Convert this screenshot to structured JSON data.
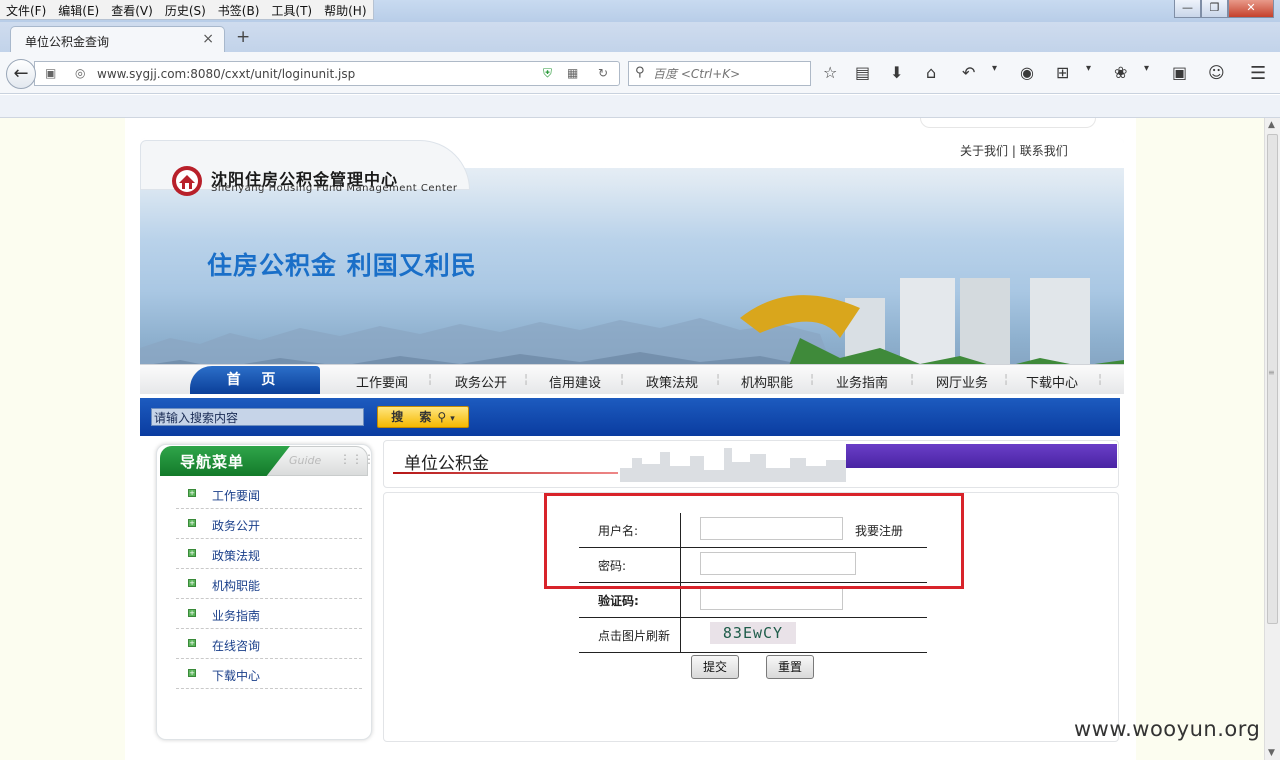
{
  "browser": {
    "menu": [
      "文件(F)",
      "编辑(E)",
      "查看(V)",
      "历史(S)",
      "书签(B)",
      "工具(T)",
      "帮助(H)"
    ],
    "tab_title": "单位公积金查询",
    "url": "www.sygjj.com:8080/cxxt/unit/loginunit.jsp",
    "search_placeholder": "百度 <Ctrl+K>"
  },
  "site": {
    "top_links": [
      "关于我们",
      "联系我们"
    ],
    "logo_name": "沈阳住房公积金管理中心",
    "logo_en": "Shenyang  Housing  Fund  Management  Center",
    "slogan": "住房公积金  利国又利民",
    "home": "首 页",
    "nav": [
      "工作要闻",
      "政务公开",
      "信用建设",
      "政策法规",
      "机构职能",
      "业务指南",
      "网厅业务",
      "下载中心"
    ],
    "search_placeholder": "请输入搜索内容",
    "search_button": "搜 索"
  },
  "sidebar": {
    "title": "导航菜单",
    "guide": "Guide",
    "items": [
      "工作要闻",
      "政务公开",
      "政策法规",
      "机构职能",
      "业务指南",
      "在线咨询",
      "下载中心"
    ]
  },
  "content": {
    "title": "单位公积金",
    "username_label": "用户名:",
    "register_link": "我要注册",
    "password_label": "密码:",
    "captcha_label": "验证码:",
    "refresh_label": "点击图片刷新",
    "captcha_text": "83EwCY",
    "submit": "提交",
    "reset": "重置"
  },
  "watermark": "www.wooyun.org",
  "colors": {
    "highlight": "#d8232a",
    "brand_blue": "#0b3f99",
    "nav_green": "#137a2a"
  }
}
